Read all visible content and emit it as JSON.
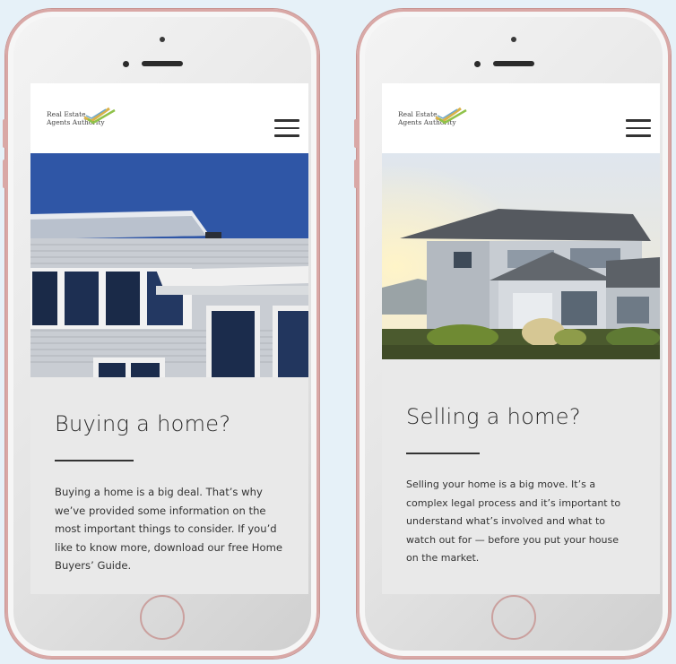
{
  "phones": [
    {
      "logo_text": "Real Estate Agents Authority",
      "card": {
        "title": "Buying a home?",
        "body": "Buying a home is a big deal. That’s why we’ve provided some information on the most important things to consider. If you’d like to know more, download our free Home Buyers’ Guide."
      }
    },
    {
      "logo_text": "Real Estate Agents Authority",
      "card": {
        "title": "Selling a home?",
        "body": "Selling your home is a big move. It’s a complex legal process and it’s important to understand what’s involved and what to watch out for — before you put your house on the market."
      }
    }
  ],
  "colors": {
    "background": "#e6f1f8",
    "phone_frame": "#d9a8a6",
    "card_bg": "#e9e9e9",
    "sky_blue": "#2f56a6",
    "logo_accent": "#8fc24a"
  },
  "icons": [
    "hamburger-menu-icon",
    "home-button-icon",
    "camera-icon",
    "speaker-icon"
  ]
}
